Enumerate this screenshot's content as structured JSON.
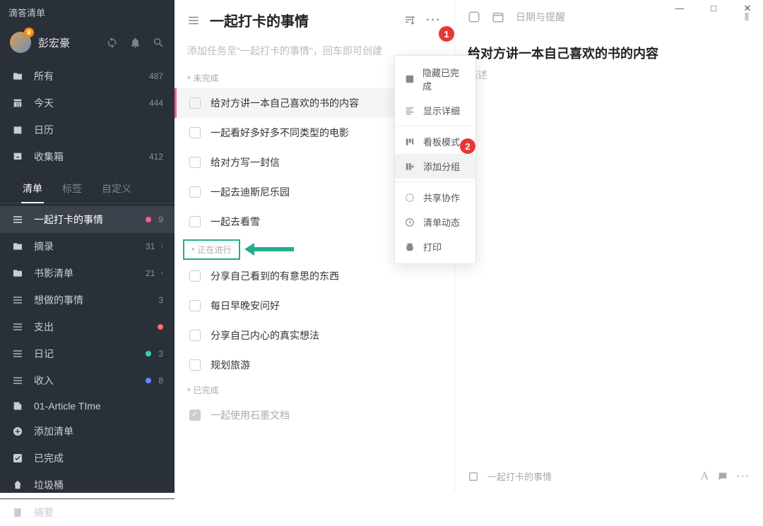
{
  "app": {
    "name": "滴答清单"
  },
  "user": {
    "name": "彭宏豪"
  },
  "nav": {
    "all": {
      "label": "所有",
      "count": "487"
    },
    "today": {
      "label": "今天",
      "count": "444"
    },
    "calendar": {
      "label": "日历"
    },
    "inbox": {
      "label": "收集箱",
      "count": "412"
    }
  },
  "tabs": {
    "list": "清单",
    "tag": "标签",
    "custom": "自定义"
  },
  "lists": [
    {
      "label": "一起打卡的事情",
      "count": "9"
    },
    {
      "label": "摘录",
      "count": "31"
    },
    {
      "label": "书影清单",
      "count": "21"
    },
    {
      "label": "想做的事情",
      "count": "3"
    },
    {
      "label": "支出"
    },
    {
      "label": "日记",
      "count": "3"
    },
    {
      "label": "收入",
      "count": "8"
    },
    {
      "label": "01-Article TIme"
    },
    {
      "label": "添加清单"
    }
  ],
  "bottom": {
    "completed": "已完成",
    "trash": "垃圾桶",
    "summary": "摘要"
  },
  "main": {
    "title": "一起打卡的事情",
    "placeholder": "添加任务至\"一起打卡的事情\"，回车即可创建",
    "sections": {
      "pending": "未完成",
      "inprogress": "正在进行",
      "done": "已完成"
    },
    "tasks_pending": [
      "给对方讲一本自己喜欢的书的内容",
      "一起看好多好多不同类型的电影",
      "给对方写一封信",
      "一起去迪斯尼乐园",
      "一起去看雪"
    ],
    "tasks_progress": [
      "分享自己看到的有意思的东西",
      "每日早晚安问好",
      "分享自己内心的真实想法",
      "规划旅游"
    ],
    "tasks_done": [
      "一起使用石墨文档"
    ]
  },
  "detail": {
    "date_label": "日期与提醒",
    "title": "给对方讲一本自己喜欢的书的内容",
    "desc_placeholder": "描述",
    "breadcrumb": "一起打卡的事情"
  },
  "dropdown": {
    "hide_done": "隐藏已完成",
    "show_detail": "显示详细",
    "kanban": "看板模式",
    "add_group": "添加分组",
    "share": "共享协作",
    "activity": "清单动态",
    "print": "打印"
  },
  "badges": {
    "b1": "1",
    "b2": "2"
  }
}
